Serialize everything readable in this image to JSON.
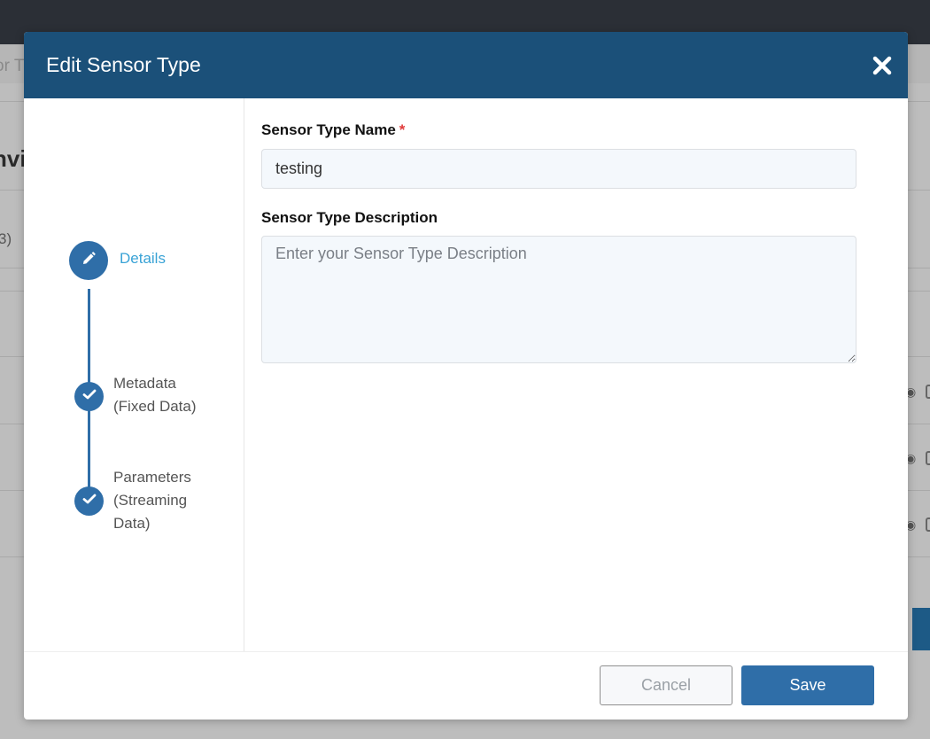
{
  "background": {
    "breadcrumb_fragment": "or T",
    "heading_fragment": "nvi",
    "count_fragment": "3)"
  },
  "modal": {
    "title": "Edit Sensor Type",
    "close_icon": "close-icon"
  },
  "stepper": {
    "steps": [
      {
        "label": "Details",
        "icon": "pencil-icon",
        "state": "active"
      },
      {
        "label_line1": "Metadata",
        "label_line2": "(Fixed Data)",
        "icon": "check-icon",
        "state": "complete"
      },
      {
        "label_line1": "Parameters",
        "label_line2": "(Streaming",
        "label_line3": "Data)",
        "icon": "check-icon",
        "state": "complete"
      }
    ]
  },
  "form": {
    "name_label": "Sensor Type Name",
    "name_required_mark": "*",
    "name_value": "testing",
    "description_label": "Sensor Type Description",
    "description_placeholder": "Enter your Sensor Type Description",
    "description_value": ""
  },
  "footer": {
    "cancel_label": "Cancel",
    "save_label": "Save"
  },
  "colors": {
    "header": "#1b5079",
    "primary": "#2f6ea8",
    "active_step_text": "#3aa3d6",
    "required": "#e03b3b"
  }
}
